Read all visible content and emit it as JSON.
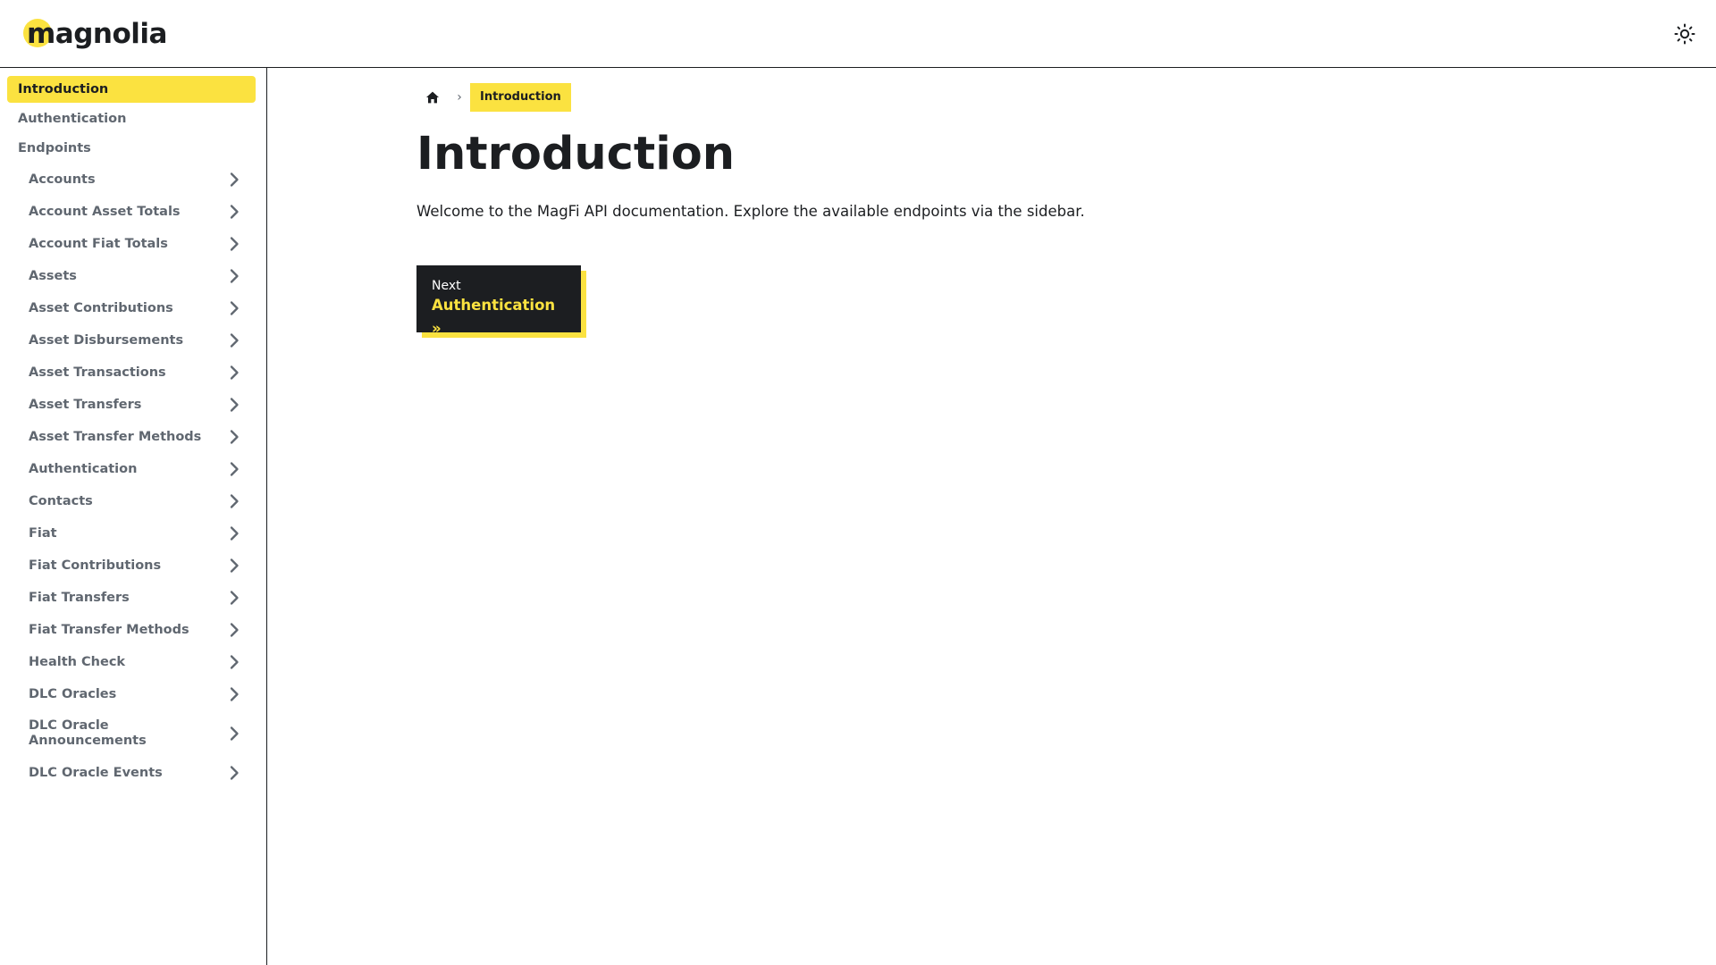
{
  "navbar": {
    "brand": "magnolia",
    "theme_icon": "sun-icon"
  },
  "sidebar": {
    "top_items": [
      {
        "label": "Introduction",
        "active": true
      },
      {
        "label": "Authentication",
        "active": false
      },
      {
        "label": "Endpoints",
        "active": false
      }
    ],
    "endpoints": [
      {
        "label": "Accounts"
      },
      {
        "label": "Account Asset Totals"
      },
      {
        "label": "Account Fiat Totals"
      },
      {
        "label": "Assets"
      },
      {
        "label": "Asset Contributions"
      },
      {
        "label": "Asset Disbursements"
      },
      {
        "label": "Asset Transactions"
      },
      {
        "label": "Asset Transfers"
      },
      {
        "label": "Asset Transfer Methods"
      },
      {
        "label": "Authentication"
      },
      {
        "label": "Contacts"
      },
      {
        "label": "Fiat"
      },
      {
        "label": "Fiat Contributions"
      },
      {
        "label": "Fiat Transfers"
      },
      {
        "label": "Fiat Transfer Methods"
      },
      {
        "label": "Health Check"
      },
      {
        "label": "DLC Oracles"
      },
      {
        "label": "DLC Oracle Announcements"
      },
      {
        "label": "DLC Oracle Events"
      }
    ],
    "expand_icon": "chevron-right-icon"
  },
  "main": {
    "breadcrumb": {
      "home_icon": "home-icon",
      "separator": "›",
      "current": "Introduction"
    },
    "title": "Introduction",
    "intro": "Welcome to the MagFi API documentation. Explore the available endpoints via the sidebar.",
    "pagination": {
      "sublabel": "Next",
      "label": "Authentication »"
    }
  },
  "colors": {
    "accent": "#fbe240",
    "text": "#1c1e21",
    "muted": "#606770",
    "background": "#ffffff"
  }
}
